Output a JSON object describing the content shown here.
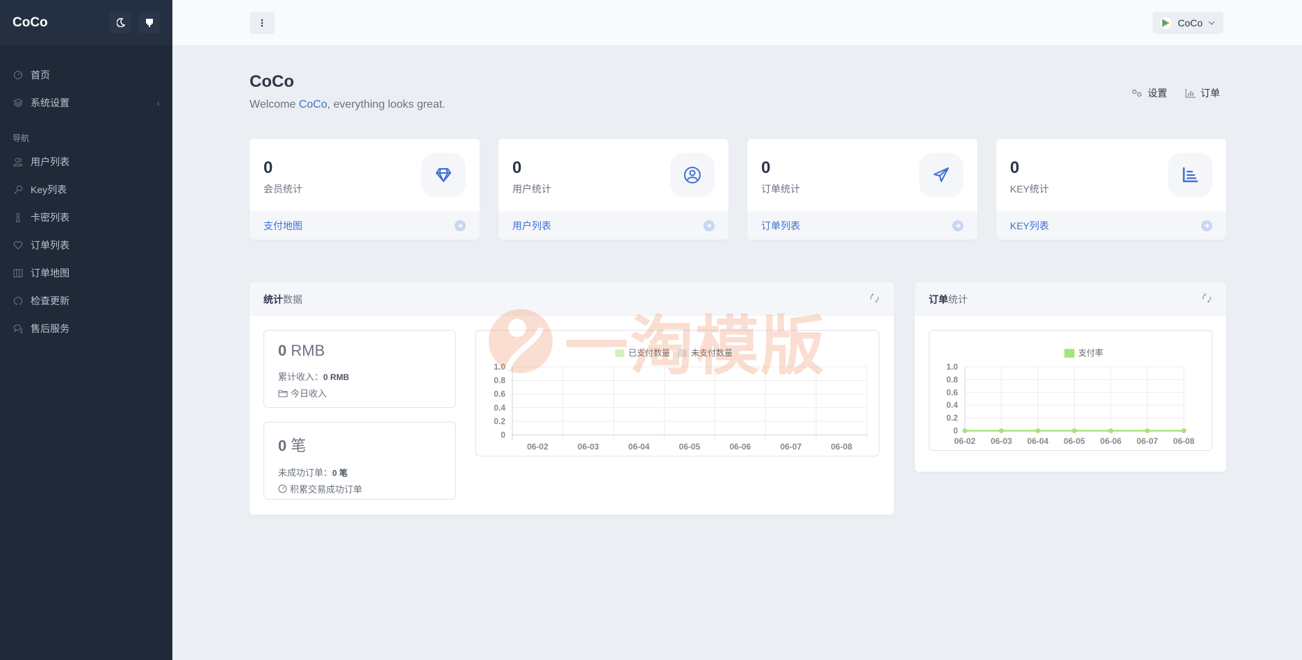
{
  "sidebar": {
    "brand": "CoCo",
    "theme_toggle_icon": "moon-icon",
    "pin_icon": "pin-icon",
    "items_top": [
      {
        "label": "首页",
        "icon": "dashboard-icon"
      },
      {
        "label": "系统设置",
        "icon": "layers-icon",
        "has_submenu": true
      }
    ],
    "section_heading": "导航",
    "items": [
      {
        "label": "用户列表",
        "icon": "users-icon"
      },
      {
        "label": "Key列表",
        "icon": "key-icon"
      },
      {
        "label": "卡密列表",
        "icon": "chess-icon"
      },
      {
        "label": "订单列表",
        "icon": "heart-icon"
      },
      {
        "label": "订单地图",
        "icon": "map-icon"
      },
      {
        "label": "检查更新",
        "icon": "refresh-icon"
      },
      {
        "label": "售后服务",
        "icon": "chat-icon"
      }
    ]
  },
  "topbar": {
    "menu_icon": "more-vertical-icon",
    "user_name": "CoCo"
  },
  "header": {
    "title": "CoCo",
    "welcome_prefix": "Welcome ",
    "welcome_name": "CoCo",
    "welcome_suffix": ", everything looks great.",
    "actions": [
      {
        "label": "设置",
        "icon": "gears-icon"
      },
      {
        "label": "订单",
        "icon": "bar-chart-icon"
      }
    ]
  },
  "stat_cards": [
    {
      "value": "0",
      "label": "会员统计",
      "link": "支付地图",
      "icon": "diamond-icon"
    },
    {
      "value": "0",
      "label": "用户统计",
      "link": "用户列表",
      "icon": "user-circle-icon"
    },
    {
      "value": "0",
      "label": "订单统计",
      "link": "订单列表",
      "icon": "paper-plane-icon"
    },
    {
      "value": "0",
      "label": "KEY统计",
      "link": "KEY列表",
      "icon": "chart-list-icon"
    }
  ],
  "stats_panel": {
    "title_bold": "统计",
    "title_rest": "数据",
    "revenue": {
      "amount": "0",
      "unit": "RMB",
      "cumulative_label": "累计收入：",
      "cumulative_value": "0 RMB",
      "today_label": "今日收入"
    },
    "orders": {
      "amount": "0",
      "unit": "笔",
      "failed_label": "未成功订单：",
      "failed_value": "0 笔",
      "success_label": "积累交易成功订单"
    }
  },
  "orders_panel": {
    "title_bold": "订单",
    "title_rest": "统计"
  },
  "watermark": "一淘模版",
  "chart_data": [
    {
      "type": "bar",
      "title": "",
      "categories": [
        "06-02",
        "06-03",
        "06-04",
        "06-05",
        "06-06",
        "06-07",
        "06-08"
      ],
      "series": [
        {
          "name": "已支付数量",
          "values": [
            0,
            0,
            0,
            0,
            0,
            0,
            0
          ],
          "color": "#d4f0c0"
        },
        {
          "name": "未支付数量",
          "values": [
            0,
            0,
            0,
            0,
            0,
            0,
            0
          ],
          "color": "#e2e2e2"
        }
      ],
      "yticks": [
        "0",
        "0.2",
        "0.4",
        "0.6",
        "0.8",
        "1.0"
      ],
      "ylim": [
        0,
        1
      ],
      "grid": true,
      "legend": "top-center",
      "xlabel": "",
      "ylabel": ""
    },
    {
      "type": "line",
      "title": "",
      "categories": [
        "06-02",
        "06-03",
        "06-04",
        "06-05",
        "06-06",
        "06-07",
        "06-08"
      ],
      "series": [
        {
          "name": "支付率",
          "values": [
            0,
            0,
            0,
            0,
            0,
            0,
            0
          ],
          "color": "#a8e27a"
        }
      ],
      "yticks": [
        "0",
        "0.2",
        "0.4",
        "0.6",
        "0.8",
        "1.0"
      ],
      "ylim": [
        0,
        1
      ],
      "grid": true,
      "legend": "top-center",
      "xlabel": "",
      "ylabel": ""
    }
  ]
}
